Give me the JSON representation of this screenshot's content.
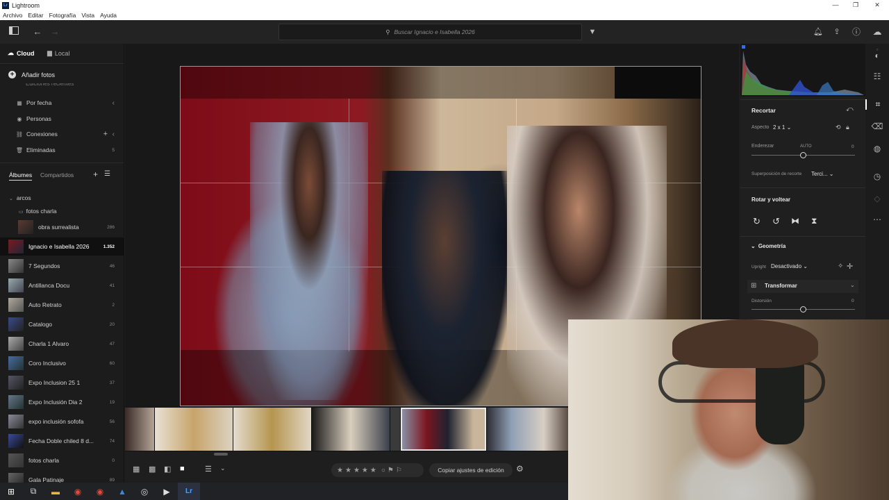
{
  "window": {
    "app_title": "Lightroom",
    "app_icon_text": "Lr"
  },
  "menu": [
    "Archivo",
    "Editar",
    "Fotografía",
    "Vista",
    "Ayuda"
  ],
  "toolbar": {
    "search_placeholder": "Buscar  Ignacio e Isabella 2026"
  },
  "left_panel": {
    "tabs": {
      "cloud": "Cloud",
      "local": "Local"
    },
    "add_photos": "Añadir fotos",
    "cut_item": "Ediciones recientes",
    "nav": [
      {
        "label": "Por fecha",
        "icon": "calendar-icon"
      },
      {
        "label": "Personas",
        "icon": "person-icon"
      },
      {
        "label": "Conexiones",
        "icon": "connections-icon"
      },
      {
        "label": "Eliminadas",
        "icon": "trash-icon",
        "count": "5"
      }
    ],
    "album_tabs": {
      "albums": "Álbumes",
      "shared": "Compartidos"
    },
    "folder": "arcos",
    "subfolder": "fotos charla",
    "albums": [
      {
        "label": "obra surrealista",
        "count": "286"
      },
      {
        "label": "Ignacio e Isabella 2026",
        "count": "1.352"
      },
      {
        "label": "7 Segundos",
        "count": "46"
      },
      {
        "label": "Antillanca Docu",
        "count": "41"
      },
      {
        "label": "Auto Retrato",
        "count": "2"
      },
      {
        "label": "Catalogo",
        "count": "20"
      },
      {
        "label": "Charla 1 Alvaro",
        "count": "47"
      },
      {
        "label": "Coro Inclusivo",
        "count": "60"
      },
      {
        "label": "Expo Inclusion  25 1",
        "count": "37"
      },
      {
        "label": "Expo Inclusión Dia 2",
        "count": "19"
      },
      {
        "label": "expo inclusión sofofa",
        "count": "56"
      },
      {
        "label": "Fecha Doble chiled 8 d...",
        "count": "74"
      },
      {
        "label": "fotos charla",
        "count": "0"
      },
      {
        "label": "Gala Patinaje",
        "count": "89"
      }
    ]
  },
  "bottom_bar": {
    "copy_settings": "Copiar ajustes de edición"
  },
  "right_panel": {
    "crop_title": "Recortar",
    "aspect_label": "Aspecto",
    "aspect_value": "2 x 1",
    "straighten_label": "Enderezar",
    "straighten_auto": "AUTO",
    "straighten_value": "0",
    "overlay_label": "Superposición de recorte",
    "overlay_value": "Terci...",
    "rotate_title": "Rotar y voltear",
    "geometry_title": "Geometría",
    "upright_label": "Upright",
    "upright_value": "Desactivado",
    "transform_title": "Transformar",
    "distortion_label": "Distorsión",
    "distortion_value": "0",
    "straighten_level": 0.5,
    "distortion_level": 0.5
  }
}
